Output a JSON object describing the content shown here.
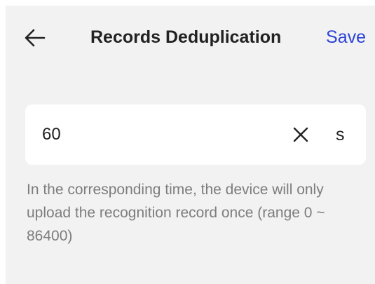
{
  "header": {
    "back_icon": "arrow-left-icon",
    "title": "Records Deduplication",
    "save_label": "Save"
  },
  "field": {
    "value": "60",
    "clear_icon": "close-icon",
    "unit": "s"
  },
  "hint": {
    "text": "In the corresponding time, the device will only upload the recognition record once (range 0 ~ 86400)"
  },
  "colors": {
    "accent": "#2d44d6",
    "background": "#f2f2f2",
    "card": "#ffffff",
    "text": "#222222",
    "hint": "#7d7d7d"
  }
}
